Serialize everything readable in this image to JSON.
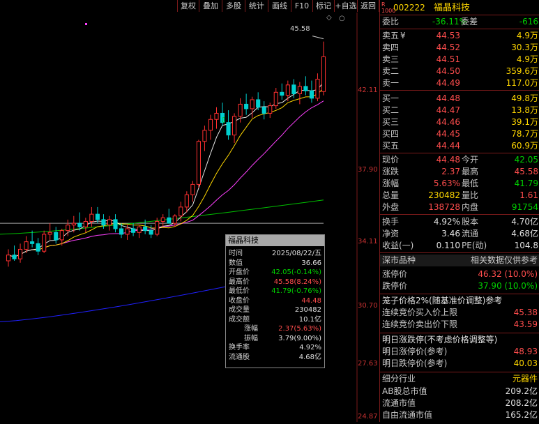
{
  "toolbar": {
    "buttons": [
      "复权",
      "叠加",
      "多股",
      "统计",
      "画线",
      "F10",
      "标记",
      "+自选",
      "返回"
    ]
  },
  "chart": {
    "price_labels": [
      "42.11",
      "37.90",
      "34.11",
      "30.70",
      "27.63",
      "24.87"
    ],
    "high_marker": "45.58",
    "tooltip": {
      "title": "福晶科技",
      "rows": [
        {
          "k": "时间",
          "v": "2025/08/22/五",
          "c": "white"
        },
        {
          "k": "数值",
          "v": "36.66",
          "c": "white"
        },
        {
          "k": "开盘价",
          "v": "42.05(-0.14%)",
          "c": "green"
        },
        {
          "k": "最高价",
          "v": "45.58(8.24%)",
          "c": "red"
        },
        {
          "k": "最低价",
          "v": "41.79(-0.76%)",
          "c": "green"
        },
        {
          "k": "收盘价",
          "v": "44.48",
          "c": "red"
        },
        {
          "k": "成交量",
          "v": "230482",
          "c": "white"
        },
        {
          "k": "成交额",
          "v": "10.1亿",
          "c": "white"
        },
        {
          "k": "涨幅",
          "v": "2.37(5.63%)",
          "c": "red"
        },
        {
          "k": "振幅",
          "v": "3.79(9.00%)",
          "c": "white"
        },
        {
          "k": "换手率",
          "v": "4.92%",
          "c": "white"
        },
        {
          "k": "流通股",
          "v": "4.68亿",
          "c": "white"
        }
      ]
    },
    "candles": [
      {
        "o": 32.0,
        "h": 32.6,
        "l": 31.7,
        "c": 32.3
      },
      {
        "o": 32.3,
        "h": 32.8,
        "l": 32.0,
        "c": 32.1
      },
      {
        "o": 32.1,
        "h": 32.9,
        "l": 31.9,
        "c": 32.6
      },
      {
        "o": 32.6,
        "h": 33.3,
        "l": 32.4,
        "c": 33.0
      },
      {
        "o": 33.0,
        "h": 33.6,
        "l": 32.7,
        "c": 32.9
      },
      {
        "o": 32.9,
        "h": 33.2,
        "l": 32.3,
        "c": 32.5
      },
      {
        "o": 32.5,
        "h": 33.6,
        "l": 32.4,
        "c": 33.4
      },
      {
        "o": 33.4,
        "h": 34.0,
        "l": 33.1,
        "c": 33.5
      },
      {
        "o": 33.5,
        "h": 33.8,
        "l": 32.9,
        "c": 33.1
      },
      {
        "o": 33.1,
        "h": 33.7,
        "l": 32.8,
        "c": 33.6
      },
      {
        "o": 33.6,
        "h": 34.2,
        "l": 33.3,
        "c": 33.9
      },
      {
        "o": 33.9,
        "h": 34.4,
        "l": 33.5,
        "c": 34.0
      },
      {
        "o": 34.0,
        "h": 34.6,
        "l": 33.6,
        "c": 33.8
      },
      {
        "o": 33.8,
        "h": 34.3,
        "l": 33.5,
        "c": 34.1
      },
      {
        "o": 34.1,
        "h": 34.9,
        "l": 33.8,
        "c": 34.5
      },
      {
        "o": 34.5,
        "h": 34.9,
        "l": 34.0,
        "c": 34.2
      },
      {
        "o": 34.2,
        "h": 34.5,
        "l": 33.7,
        "c": 33.9
      },
      {
        "o": 33.9,
        "h": 34.4,
        "l": 33.6,
        "c": 34.2
      },
      {
        "o": 34.2,
        "h": 34.5,
        "l": 33.5,
        "c": 33.7
      },
      {
        "o": 33.7,
        "h": 34.0,
        "l": 33.2,
        "c": 33.4
      },
      {
        "o": 33.4,
        "h": 33.9,
        "l": 33.1,
        "c": 33.7
      },
      {
        "o": 33.7,
        "h": 34.0,
        "l": 33.3,
        "c": 33.5
      },
      {
        "o": 33.5,
        "h": 33.9,
        "l": 33.2,
        "c": 33.8
      },
      {
        "o": 33.8,
        "h": 34.2,
        "l": 33.4,
        "c": 33.6
      },
      {
        "o": 33.6,
        "h": 33.9,
        "l": 33.2,
        "c": 33.4
      },
      {
        "o": 33.4,
        "h": 34.3,
        "l": 33.3,
        "c": 34.1
      },
      {
        "o": 34.1,
        "h": 34.5,
        "l": 33.8,
        "c": 34.3
      },
      {
        "o": 34.3,
        "h": 34.8,
        "l": 34.0,
        "c": 34.0
      },
      {
        "o": 34.0,
        "h": 34.5,
        "l": 33.8,
        "c": 34.4
      },
      {
        "o": 34.4,
        "h": 35.2,
        "l": 34.1,
        "c": 34.9
      },
      {
        "o": 34.9,
        "h": 35.8,
        "l": 34.6,
        "c": 35.6
      },
      {
        "o": 35.6,
        "h": 36.4,
        "l": 35.2,
        "c": 36.2
      },
      {
        "o": 36.2,
        "h": 38.9,
        "l": 36.0,
        "c": 38.8
      },
      {
        "o": 38.8,
        "h": 39.8,
        "l": 38.2,
        "c": 39.5
      },
      {
        "o": 39.5,
        "h": 40.5,
        "l": 38.9,
        "c": 40.2
      },
      {
        "o": 40.2,
        "h": 41.0,
        "l": 39.6,
        "c": 40.6
      },
      {
        "o": 40.6,
        "h": 41.3,
        "l": 39.8,
        "c": 40.0
      },
      {
        "o": 40.0,
        "h": 40.8,
        "l": 38.9,
        "c": 39.2
      },
      {
        "o": 39.2,
        "h": 40.6,
        "l": 38.7,
        "c": 40.4
      },
      {
        "o": 40.4,
        "h": 41.6,
        "l": 40.0,
        "c": 41.2
      },
      {
        "o": 41.2,
        "h": 41.9,
        "l": 40.5,
        "c": 40.9
      },
      {
        "o": 40.9,
        "h": 41.7,
        "l": 40.3,
        "c": 41.5
      },
      {
        "o": 41.5,
        "h": 42.0,
        "l": 40.8,
        "c": 41.0
      },
      {
        "o": 41.0,
        "h": 41.4,
        "l": 40.2,
        "c": 40.6
      },
      {
        "o": 40.6,
        "h": 41.3,
        "l": 40.3,
        "c": 41.1
      },
      {
        "o": 41.1,
        "h": 42.3,
        "l": 40.9,
        "c": 42.0
      },
      {
        "o": 42.0,
        "h": 42.6,
        "l": 41.5,
        "c": 41.8
      },
      {
        "o": 41.8,
        "h": 42.8,
        "l": 41.4,
        "c": 42.5
      },
      {
        "o": 42.5,
        "h": 42.9,
        "l": 41.6,
        "c": 41.9
      },
      {
        "o": 41.9,
        "h": 42.7,
        "l": 41.2,
        "c": 42.4
      },
      {
        "o": 42.4,
        "h": 43.1,
        "l": 41.8,
        "c": 42.1
      },
      {
        "o": 42.1,
        "h": 42.8,
        "l": 41.3,
        "c": 41.6
      },
      {
        "o": 41.6,
        "h": 43.3,
        "l": 41.4,
        "c": 42.9
      },
      {
        "o": 42.05,
        "h": 45.58,
        "l": 41.79,
        "c": 44.48
      }
    ]
  },
  "quote": {
    "code": "002222",
    "name": "福晶科技",
    "wb_label": "委比",
    "wb_value": "-36.11%",
    "wc_label": "委差",
    "wc_value": "-616",
    "asks": [
      {
        "label": "卖五",
        "mark": "¥",
        "price": "44.53",
        "vol": "4.9万"
      },
      {
        "label": "卖四",
        "mark": "",
        "price": "44.52",
        "vol": "30.3万"
      },
      {
        "label": "卖三",
        "mark": "",
        "price": "44.51",
        "vol": "4.9万"
      },
      {
        "label": "卖二",
        "mark": "",
        "price": "44.50",
        "vol": "359.6万"
      },
      {
        "label": "卖一",
        "mark": "",
        "price": "44.49",
        "vol": "117.0万"
      }
    ],
    "bids": [
      {
        "label": "买一",
        "price": "44.48",
        "vol": "49.8万"
      },
      {
        "label": "买二",
        "price": "44.47",
        "vol": "13.8万"
      },
      {
        "label": "买三",
        "price": "44.46",
        "vol": "39.1万"
      },
      {
        "label": "买四",
        "price": "44.45",
        "vol": "78.7万"
      },
      {
        "label": "买五",
        "price": "44.44",
        "vol": "60.9万"
      }
    ],
    "stats": [
      {
        "l1": "现价",
        "v1": "44.48",
        "c1": "red",
        "l2": "今开",
        "v2": "42.05",
        "c2": "green"
      },
      {
        "l1": "涨跌",
        "v1": "2.37",
        "c1": "red",
        "l2": "最高",
        "v2": "45.58",
        "c2": "red"
      },
      {
        "l1": "涨幅",
        "v1": "5.63%",
        "c1": "red",
        "l2": "最低",
        "v2": "41.79",
        "c2": "green"
      },
      {
        "l1": "总量",
        "v1": "230482",
        "c1": "yellow",
        "l2": "量比",
        "v2": "1.61",
        "c2": "red"
      },
      {
        "l1": "外盘",
        "v1": "138728",
        "c1": "red",
        "l2": "内盘",
        "v2": "91754",
        "c2": "green"
      }
    ],
    "stats2": [
      {
        "l1": "换手",
        "v1": "4.92%",
        "l2": "股本",
        "v2": "4.70亿"
      },
      {
        "l1": "净资",
        "v1": "3.46",
        "l2": "流通",
        "v2": "4.68亿"
      },
      {
        "l1": "收益(一)",
        "v1": "0.110",
        "l2": "PE(动)",
        "v2": "104.8"
      }
    ],
    "market_left": "深市品种",
    "market_right": "相关数据仅供参考",
    "limit_up_label": "涨停价",
    "limit_up": "46.32 (10.0%)",
    "limit_down_label": "跌停价",
    "limit_down": "37.90 (10.0%)",
    "cage_title": "笼子价格2%(随基准价调整)参考",
    "cage_buy_label": "连续竞价买入价上限",
    "cage_buy": "45.38",
    "cage_sell_label": "连续竞价卖出价下限",
    "cage_sell": "43.59",
    "tmr_title": "明日涨跌停(不考虑价格调整等)",
    "tmr_up_label": "明日涨停价(参考)",
    "tmr_up": "48.93",
    "tmr_down_label": "明日跌停价(参考)",
    "tmr_down": "40.03",
    "industry_label": "细分行业",
    "industry": "元器件",
    "ab_label": "AB股总市值",
    "ab_value": "209.2亿",
    "float_label": "流通市值",
    "float_value": "208.2亿",
    "free_label": "自由流通市值",
    "free_value": "165.2亿"
  },
  "colors": {
    "up": "#ff3030",
    "down": "#00d0d0",
    "ma5": "#e8e8e8",
    "ma10": "#ffd700",
    "ma20": "#ff40ff",
    "ma60": "#00c000",
    "ma120": "#a0a0a0",
    "ma250": "#2020ff",
    "border": "#7a1a1a"
  }
}
